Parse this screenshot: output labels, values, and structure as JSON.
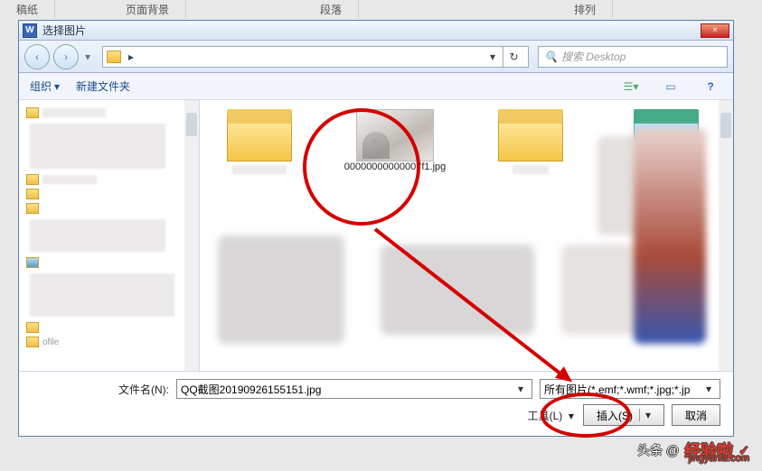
{
  "ribbon": {
    "tabs": [
      "稿纸",
      "页面背景",
      "段落",
      "排列"
    ]
  },
  "dialog": {
    "title": "选择图片",
    "close": "×",
    "nav": {
      "back": "‹",
      "fwd": "›",
      "breadcrumb_sep": "▸",
      "refresh": "↻",
      "dropdown": "▾"
    },
    "search": {
      "placeholder": "搜索 Desktop"
    },
    "toolbar": {
      "organize": "组织",
      "org_dd": "▾",
      "newfolder": "新建文件夹",
      "view_dd": "▾",
      "help": "?"
    },
    "side_items": [
      {
        "name": ""
      },
      {
        "name": ""
      },
      {
        "name": ""
      }
    ],
    "files": {
      "selected_name": "00000000000007f1.jpg"
    },
    "bottom": {
      "filename_label": "文件名(N):",
      "filename_value": "QQ截图20190926155151.jpg",
      "filter_value": "所有图片(*.emf;*.wmf;*.jpg;*.jp",
      "tools_label": "工具(L)",
      "tools_dd": "▾",
      "insert_label": "插入(S)",
      "insert_dd": "▾",
      "cancel_label": "取消"
    }
  },
  "watermark": {
    "prefix": "头条 @",
    "brand": "经验啦",
    "check": "✓",
    "url": "jingyanla.com"
  }
}
